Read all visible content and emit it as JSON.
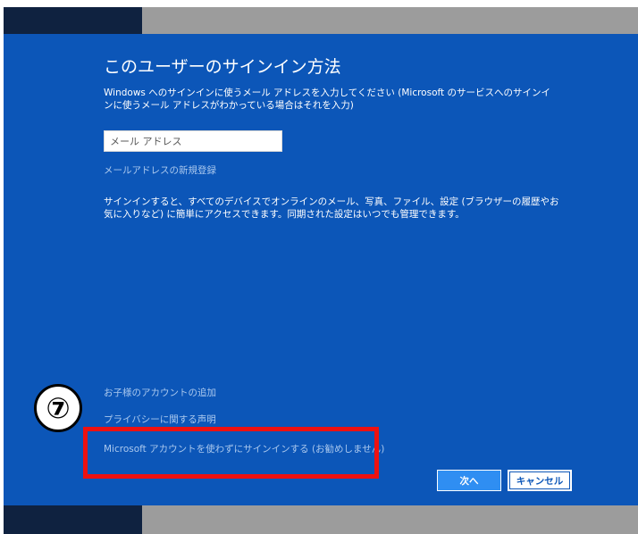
{
  "dialog": {
    "title": "このユーザーのサインイン方法",
    "instruction": "Windows へのサインインに使うメール アドレスを入力してください (Microsoft のサービスへのサインインに使うメール アドレスがわかっている場合はそれを入力)",
    "email_placeholder": "メール アドレス",
    "email_value": "",
    "new_account_link": "メールアドレスの新規登録",
    "description": "サインインすると、すべてのデバイスでオンラインのメール、写真、ファイル、設定 (ブラウザーの履歴やお気に入りなど) に簡単にアクセスできます。同期された設定はいつでも管理できます。",
    "child_account_link": "お子様のアカウントの追加",
    "privacy_link": "プライバシーに関する声明",
    "no_ms_account_link": "Microsoft アカウントを使わずにサインインする (お勧めしません)",
    "next_button": "次へ",
    "cancel_button": "キャンセル"
  },
  "annotation": {
    "step_number": "⑦"
  },
  "colors": {
    "panel_blue": "#0c56b8",
    "link_blue": "#aac8ee",
    "next_button_blue": "#2f8ef2",
    "highlight_red": "#ee1111",
    "top_bar_dark": "#0f2240",
    "top_bar_gray": "#9c9c9c"
  }
}
